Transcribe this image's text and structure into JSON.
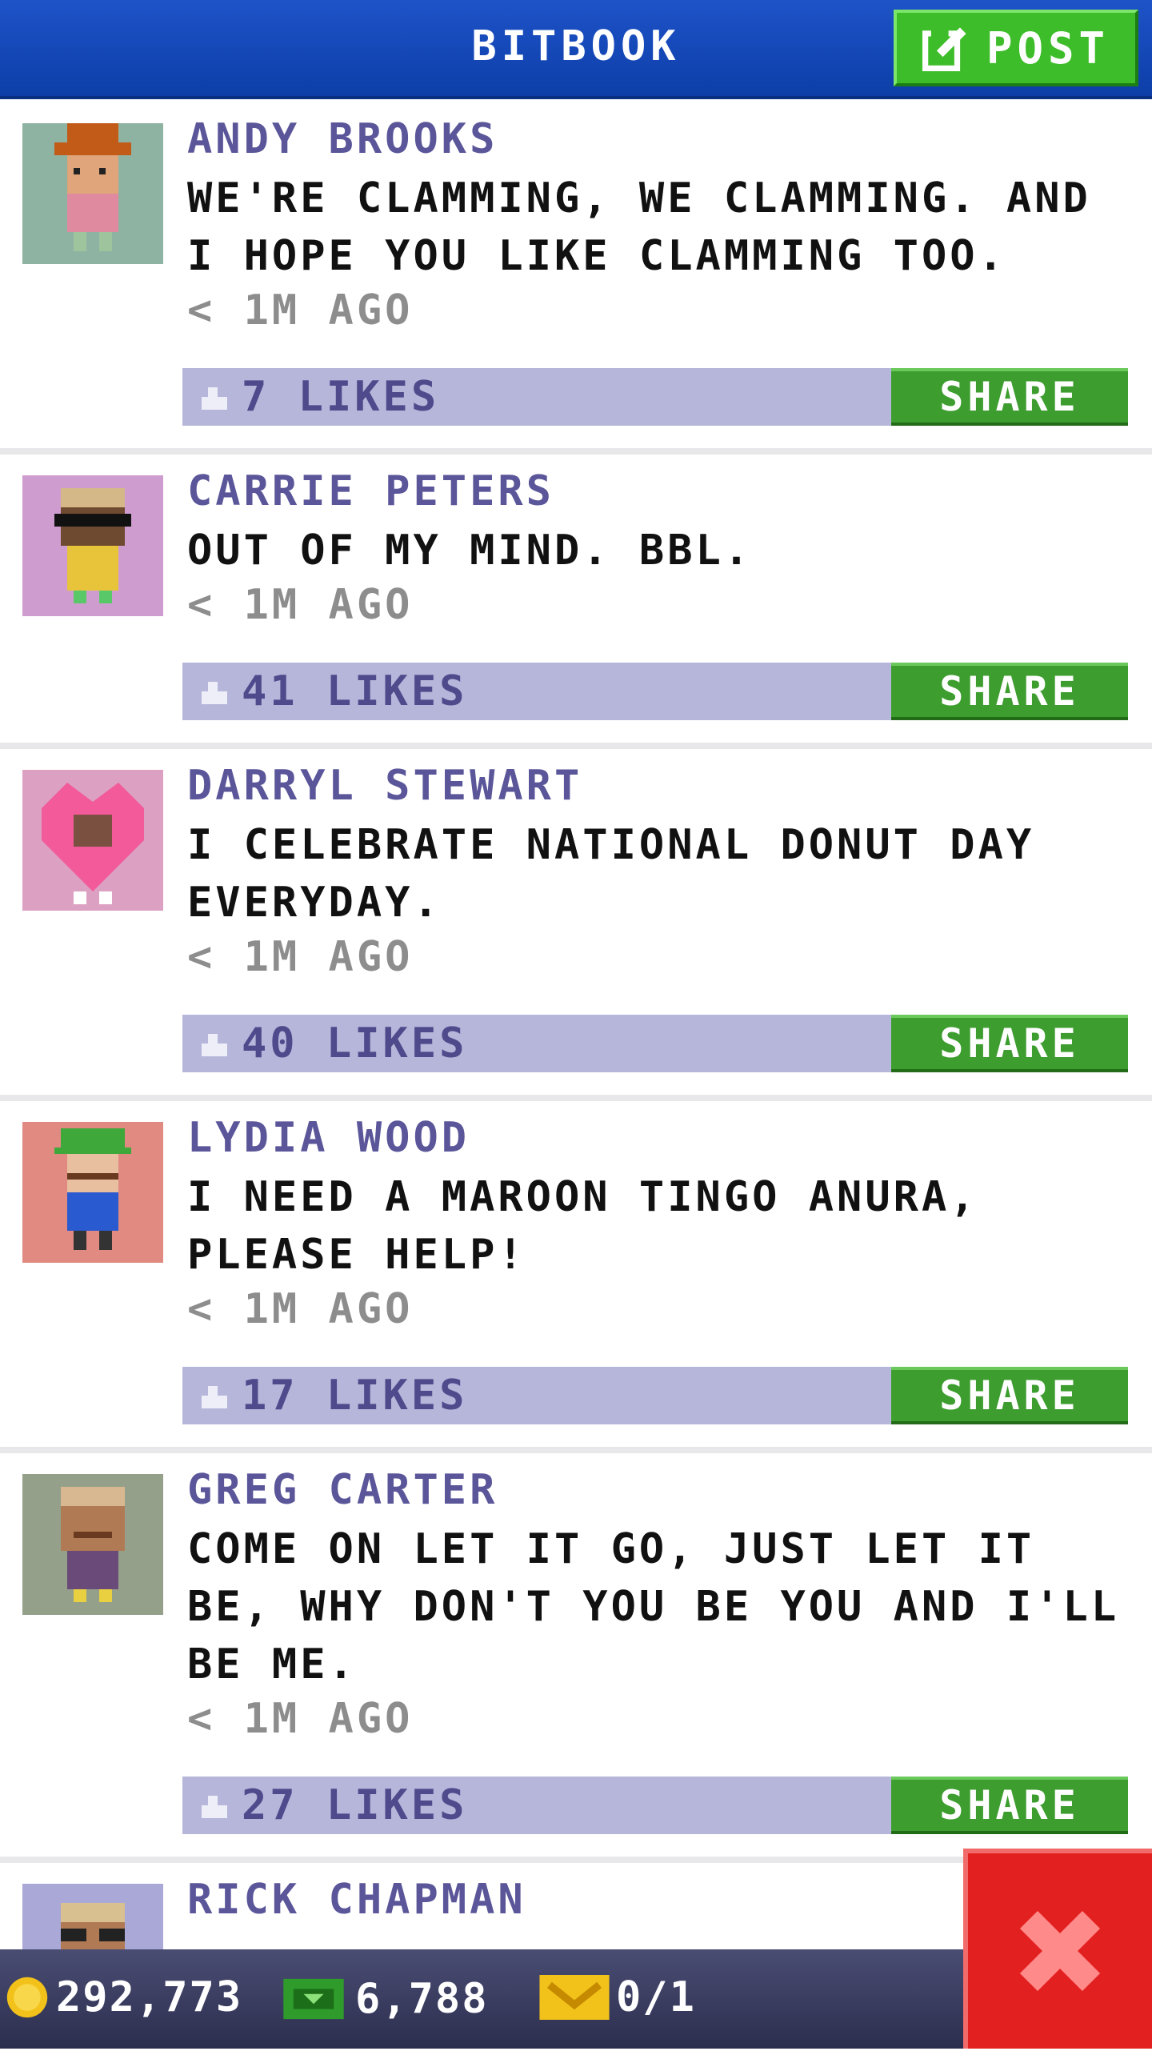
{
  "header": {
    "title": "BITBOOK",
    "post_label": "POST"
  },
  "posts": [
    {
      "name": "ANDY BROOKS",
      "message": "WE'RE CLAMMING, WE CLAMMING. AND I HOPE YOU LIKE CLAMMING TOO.",
      "time": "< 1M AGO",
      "likes": "7 LIKES",
      "share_label": "SHARE",
      "avatar_bg": "#8fb3a2",
      "avatar_desc": "person-orange-hat-icon"
    },
    {
      "name": "CARRIE PETERS",
      "message": "OUT OF MY MIND. BBL.",
      "time": "< 1M AGO",
      "likes": "41 LIKES",
      "share_label": "SHARE",
      "avatar_bg": "#cf9ccf",
      "avatar_desc": "person-sunglasses-icon"
    },
    {
      "name": "DARRYL STEWART",
      "message": "I CELEBRATE NATIONAL DONUT DAY EVERYDAY.",
      "time": "< 1M AGO",
      "likes": "40 LIKES",
      "share_label": "SHARE",
      "avatar_bg": "#dca0c3",
      "avatar_desc": "person-heart-costume-icon"
    },
    {
      "name": "LYDIA WOOD",
      "message": "I NEED A MAROON TINGO ANURA, PLEASE HELP!",
      "time": "< 1M AGO",
      "likes": "17 LIKES",
      "share_label": "SHARE",
      "avatar_bg": "#e08a82",
      "avatar_desc": "person-green-cap-icon"
    },
    {
      "name": "GREG CARTER",
      "message": "COME ON LET IT GO, JUST LET IT BE, WHY DON'T YOU BE YOU AND I'LL BE ME.",
      "time": "< 1M AGO",
      "likes": "27 LIKES",
      "share_label": "SHARE",
      "avatar_bg": "#94a08a",
      "avatar_desc": "person-bald-icon"
    },
    {
      "name": "RICK CHAPMAN",
      "avatar_bg": "#a9a8d6",
      "avatar_desc": "person-glasses-icon"
    }
  ],
  "status": {
    "coins": "292,773",
    "bux": "6,788",
    "tickets": "0/1"
  },
  "colors": {
    "header_blue": "#1e53c8",
    "action_green": "#3d9d2f",
    "like_bar": "#b5b6da",
    "name_purple": "#5a5699",
    "close_red": "#e32020"
  }
}
